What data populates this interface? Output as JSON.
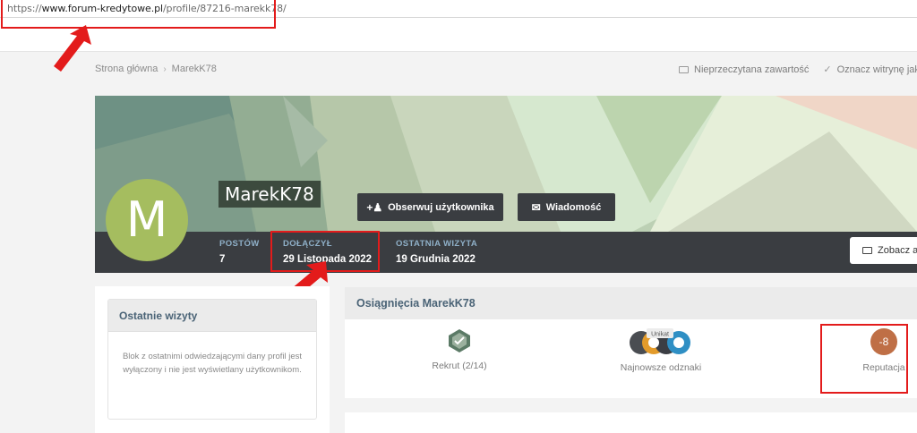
{
  "browser": {
    "url_prefix": "https://",
    "url_host": "www.forum-kredytowe.pl",
    "url_path": "/profile/87216-marekk78/"
  },
  "breadcrumb": {
    "home": "Strona główna",
    "separator": "›",
    "current": "MarekK78"
  },
  "top_links": {
    "unread": "Nieprzeczytana zawartość",
    "mark_read": "Oznacz witrynę jak"
  },
  "profile": {
    "avatar_letter": "M",
    "username": "MarekK78",
    "follow_button": "Obserwuj użytkownika",
    "message_button": "Wiadomość",
    "view_button": "Zobacz al",
    "stats": {
      "posts_label": "POSTÓW",
      "posts_value": "7",
      "joined_label": "DOŁĄCZYŁ",
      "joined_value": "29 Listopada 2022",
      "last_visit_label": "OSTATNIA WIZYTA",
      "last_visit_value": "19 Grudnia 2022"
    },
    "colors": {
      "avatar": "#a5bd5f",
      "stats_bar": "#3a3d41",
      "highlight": "#e31b1b"
    }
  },
  "recent_visits": {
    "title": "Ostatnie wizyty",
    "text": "Blok z ostatnimi odwiedzającymi dany profil jest wyłączony i nie jest wyświetlany użytkownikom."
  },
  "achievements": {
    "title": "Osiągnięcia MarekK78",
    "rank_label": "Rekrut (2/14)",
    "badges_label": "Najnowsze odznaki",
    "badge_tag": "Unikat",
    "reputation_value": "-8",
    "reputation_label": "Reputacja"
  }
}
